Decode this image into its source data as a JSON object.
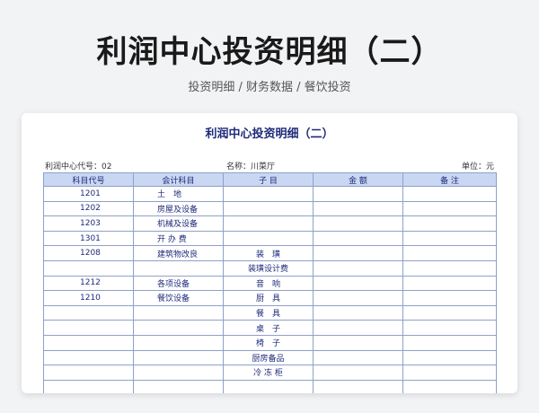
{
  "hero": {
    "title": "利润中心投资明细（二）",
    "subtitle": "投资明细 / 财务数据 / 餐饮投资"
  },
  "sheet": {
    "title": "利润中心投资明细（二）",
    "center_code": "利润中心代号：02",
    "name": "名称：川菜厅",
    "unit": "单位：元"
  },
  "table": {
    "headers": [
      "科目代号",
      "会计科目",
      "子 目",
      "金 额",
      "备 注"
    ],
    "rows": [
      [
        "1201",
        "土　地",
        "",
        "",
        ""
      ],
      [
        "1202",
        "房屋及设备",
        "",
        "",
        ""
      ],
      [
        "1203",
        "机械及设备",
        "",
        "",
        ""
      ],
      [
        "1301",
        "开 办 费",
        "",
        "",
        ""
      ],
      [
        "1208",
        "建筑物改良",
        "装　璜",
        "",
        ""
      ],
      [
        "",
        "",
        "装璜设计费",
        "",
        ""
      ],
      [
        "1212",
        "各项设备",
        "音　响",
        "",
        ""
      ],
      [
        "1210",
        "餐饮设备",
        "厨　具",
        "",
        ""
      ],
      [
        "",
        "",
        "餐　具",
        "",
        ""
      ],
      [
        "",
        "",
        "桌　子",
        "",
        ""
      ],
      [
        "",
        "",
        "椅　子",
        "",
        ""
      ],
      [
        "",
        "",
        "厨房备品",
        "",
        ""
      ],
      [
        "",
        "",
        "冷 冻 柜",
        "",
        ""
      ],
      [
        "",
        "",
        "",
        "",
        ""
      ]
    ]
  }
}
